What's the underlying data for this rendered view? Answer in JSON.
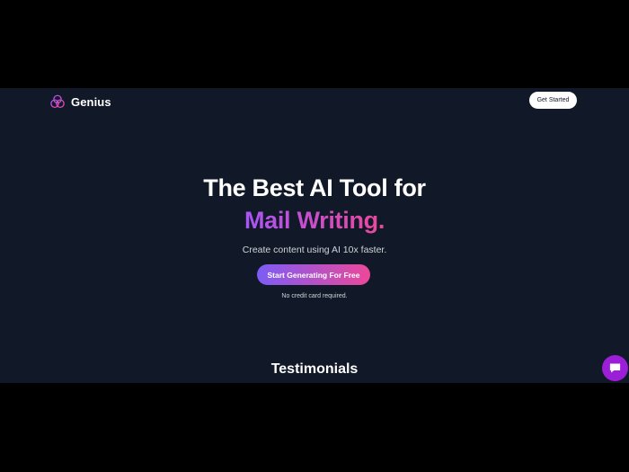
{
  "navbar": {
    "brand_name": "Genius",
    "logo_icon": "interlocking-circles-icon",
    "get_started_label": "Get Started"
  },
  "hero": {
    "title_line1": "The Best AI Tool for",
    "title_line2": "Mail Writing.",
    "subtitle": "Create content using AI 10x faster.",
    "cta_label": "Start Generating For Free",
    "cta_note": "No credit card required."
  },
  "testimonials": {
    "heading": "Testimonials"
  },
  "chat_widget": {
    "icon": "chat-bubble-icon"
  },
  "colors": {
    "background": "#111827",
    "accent_purple": "#a855f7",
    "accent_pink": "#ec4899",
    "chat_widget": "#9b1fd6"
  }
}
